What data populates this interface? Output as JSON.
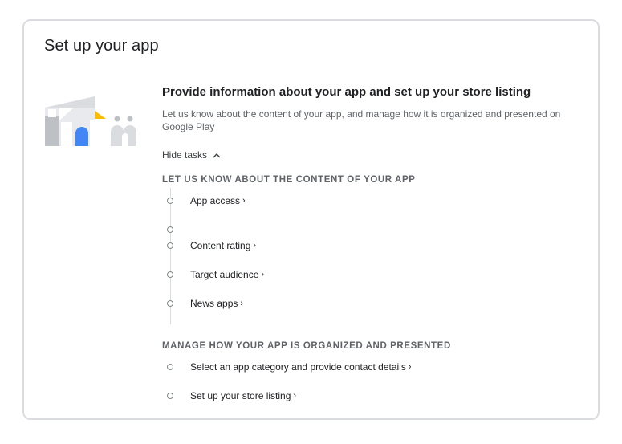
{
  "card": {
    "title": "Set up your app"
  },
  "section": {
    "title": "Provide information about your app and set up your store listing",
    "description": "Let us know about the content of your app, and manage how it is organized and presented on Google Play",
    "hide_tasks_label": "Hide tasks"
  },
  "groups": [
    {
      "heading": "LET US KNOW ABOUT THE CONTENT OF YOUR APP",
      "tasks": [
        {
          "label": "App access"
        },
        {
          "label": ""
        },
        {
          "label": "Content rating"
        },
        {
          "label": "Target audience"
        },
        {
          "label": "News apps"
        }
      ]
    },
    {
      "heading": "MANAGE HOW YOUR APP IS ORGANIZED AND PRESENTED",
      "tasks": [
        {
          "label": "Select an app category and provide contact details"
        },
        {
          "label": "Set up your store listing"
        }
      ]
    }
  ],
  "icons": {
    "chevron_up": "chevron-up-icon",
    "chevron_right": "chevron-right-icon",
    "illustration": "app-setup-illustration"
  },
  "colors": {
    "blue": "#4285f4",
    "yellow": "#fbbc04",
    "grey": "#bdc1c6",
    "border": "#dadce0"
  }
}
